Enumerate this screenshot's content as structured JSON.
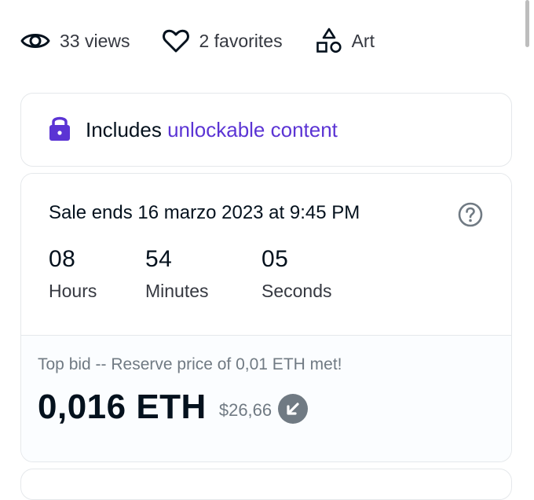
{
  "stats": {
    "views": "33 views",
    "favorites": "2 favorites",
    "category": "Art"
  },
  "icons": {
    "views": "eye-icon",
    "favorites": "heart-icon",
    "category": "shapes-icon",
    "unlock": "lock-icon",
    "help": "question-circle-icon",
    "trend": "arrow-down-left-icon"
  },
  "unlockable": {
    "prefix": "Includes",
    "link": "unlockable content"
  },
  "sale": {
    "ends": "Sale ends 16 marzo 2023 at 9:45 PM",
    "countdown": {
      "hours_value": "08",
      "hours_label": "Hours",
      "minutes_value": "54",
      "minutes_label": "Minutes",
      "seconds_value": "05",
      "seconds_label": "Seconds"
    },
    "top_bid_label": "Top bid -- Reserve price of 0,01 ETH met!",
    "price_eth": "0,016 ETH",
    "price_usd": "$26,66"
  },
  "colors": {
    "accent": "#5b34d4",
    "text_primary": "#04111d",
    "text_secondary": "#707a83",
    "border": "#e5e8eb"
  }
}
